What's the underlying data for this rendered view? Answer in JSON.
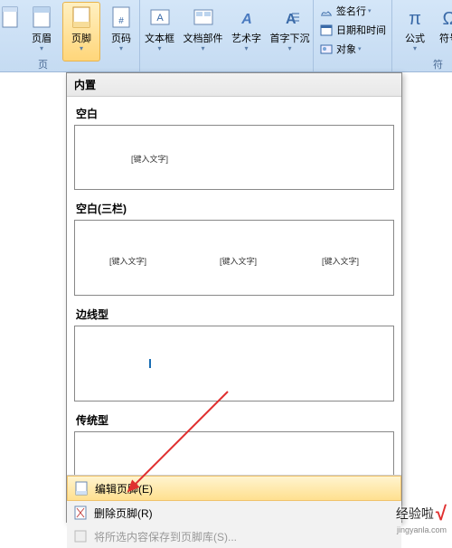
{
  "ribbon": {
    "group1_label": "页",
    "group2_label": "符",
    "header_btn": "页眉",
    "footer_btn": "页脚",
    "pagenum_btn": "页码",
    "textbox_btn": "文本框",
    "parts_btn": "文档部件",
    "wordart_btn": "艺术字",
    "dropcap_btn": "首字下沉",
    "equation_btn": "公式",
    "symbol_btn": "符号",
    "signature": "签名行",
    "datetime": "日期和时间",
    "object": "对象"
  },
  "dropdown": {
    "header": "内置",
    "tpl_blank": "空白",
    "tpl_blank3": "空白(三栏)",
    "tpl_edge": "边线型",
    "tpl_classic": "传统型",
    "placeholder": "[键入文字]",
    "page_number": "1",
    "edit_footer": "编辑页脚(E)",
    "remove_footer": "删除页脚(R)",
    "save_to_gallery": "将所选内容保存到页脚库(S)..."
  },
  "watermark": {
    "brand": "经验啦",
    "url": "jingyanla.com"
  }
}
